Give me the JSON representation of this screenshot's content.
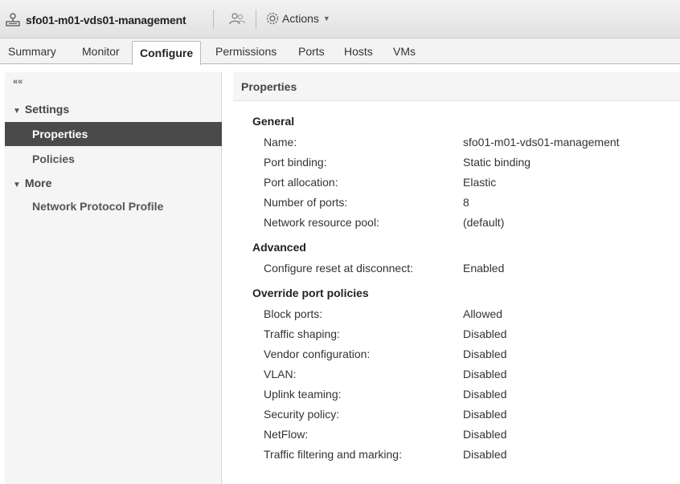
{
  "header": {
    "title": "sfo01-m01-vds01-management",
    "actions_label": "Actions"
  },
  "tabs": [
    {
      "label": "Summary"
    },
    {
      "label": "Monitor"
    },
    {
      "label": "Configure"
    },
    {
      "label": "Permissions"
    },
    {
      "label": "Ports"
    },
    {
      "label": "Hosts"
    },
    {
      "label": "VMs"
    }
  ],
  "sidebar": {
    "collapse_glyph": "««",
    "sections": [
      {
        "label": "Settings",
        "items": [
          {
            "label": "Properties"
          },
          {
            "label": "Policies"
          }
        ]
      },
      {
        "label": "More",
        "items": [
          {
            "label": "Network Protocol Profile"
          }
        ]
      }
    ]
  },
  "main": {
    "panel_title": "Properties",
    "groups": [
      {
        "title": "General",
        "rows": [
          {
            "label": "Name:",
            "value": "sfo01-m01-vds01-management"
          },
          {
            "label": "Port binding:",
            "value": "Static binding"
          },
          {
            "label": "Port allocation:",
            "value": "Elastic"
          },
          {
            "label": "Number of ports:",
            "value": "8"
          },
          {
            "label": "Network resource pool:",
            "value": "(default)"
          }
        ]
      },
      {
        "title": "Advanced",
        "rows": [
          {
            "label": "Configure reset at disconnect:",
            "value": "Enabled"
          }
        ]
      },
      {
        "title": "Override port policies",
        "rows": [
          {
            "label": "Block ports:",
            "value": "Allowed"
          },
          {
            "label": "Traffic shaping:",
            "value": "Disabled"
          },
          {
            "label": "Vendor configuration:",
            "value": "Disabled"
          },
          {
            "label": "VLAN:",
            "value": "Disabled"
          },
          {
            "label": "Uplink teaming:",
            "value": "Disabled"
          },
          {
            "label": "Security policy:",
            "value": "Disabled"
          },
          {
            "label": "NetFlow:",
            "value": "Disabled"
          },
          {
            "label": "Traffic filtering and marking:",
            "value": "Disabled"
          }
        ]
      }
    ]
  },
  "icons": {
    "switch": "network-switch-icon",
    "users": "users-icon",
    "actions": "gear-icon",
    "dropdown": "chevron-down-icon"
  },
  "colors": {
    "selected_nav_bg": "#4a4a4a",
    "tab_bar_bg": "#f3f3f3",
    "sidebar_bg": "#f5f5f5"
  }
}
